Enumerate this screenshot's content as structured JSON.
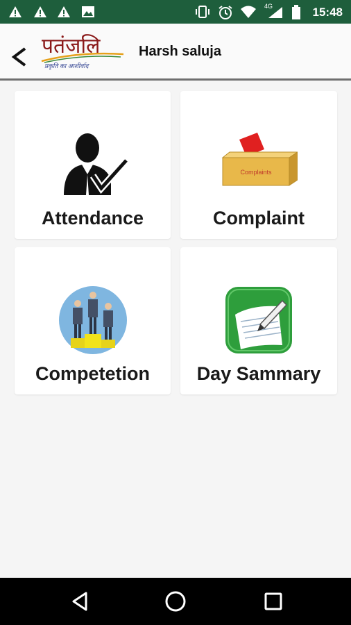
{
  "status_bar": {
    "time": "15:48",
    "network": "4G",
    "left_icons": [
      "warning-icon",
      "warning-icon",
      "warning-icon",
      "image-icon"
    ],
    "right_icons": [
      "vibrate-icon",
      "alarm-icon",
      "wifi-icon",
      "signal-icon",
      "battery-icon"
    ]
  },
  "header": {
    "logo_text": "पतंजलि",
    "logo_tagline": "प्रकृति का आशीर्वाद",
    "user_name": "Harsh saluja"
  },
  "tiles": [
    {
      "label": "Attendance",
      "icon": "attendance-icon"
    },
    {
      "label": "Complaint",
      "icon": "complaint-box-icon",
      "icon_text": "Complaints"
    },
    {
      "label": "Competetion",
      "icon": "competition-podium-icon"
    },
    {
      "label": "Day Sammary",
      "icon": "notepad-icon"
    }
  ],
  "nav": [
    "back-triangle-icon",
    "home-circle-icon",
    "recents-square-icon"
  ],
  "colors": {
    "status_bar": "#1e5e3c",
    "header_bg": "#fafafa",
    "page_bg": "#f5f5f5",
    "logo_red": "#8b1a1a"
  }
}
